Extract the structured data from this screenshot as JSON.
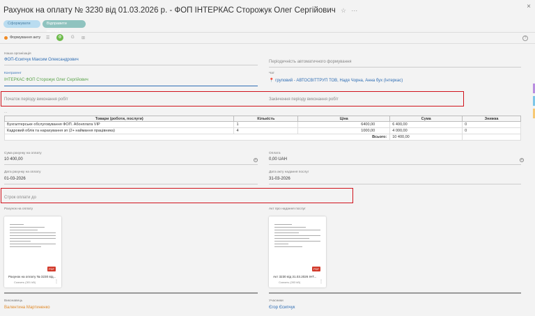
{
  "header": {
    "title": "Рахунок на оплату № 3230 від 01.03.2026 р. - ФОП ІНТЕРКАС Сторожук Олег Сергійович",
    "star_icon": "☆",
    "more_icon": "⋯",
    "close_icon": "×"
  },
  "actions": {
    "form_label": "Сформувати",
    "send_label": "Відправити рахунок"
  },
  "toolbar": {
    "status_label": "Формування акту",
    "status_color": "#f08a24",
    "accent_color": "#6dbb4b"
  },
  "form": {
    "our_org_label": "Наша організація",
    "our_org_value": "ФОП-Єсипчук Максим Олександрович",
    "periodicity_placeholder": "Періодичність автоматичного формування",
    "contractor_label": "Контрагент",
    "contractor_value": "ІНТЕРКАС ФОП Сторожук Олег Сергійович",
    "chat_label": "Чат",
    "chat_value": "груповий - АВТОСВІТТРУП ТОВ, Надя Чорна, Анна бух (Інтеркас)",
    "period_start_placeholder": "Початок періоду виконання робіт",
    "period_end_placeholder": "Закінчення періоду виконання робіт",
    "amount_label": "Сума рахунку на оплату",
    "amount_value": "10 400,00",
    "payment_label": "Оплата",
    "payment_value": "0,00 UAH",
    "invoice_date_label": "Дата рахунку на оплату",
    "invoice_date_value": "01-03-2026",
    "act_date_label": "Дата акту надання послуг",
    "act_date_value": "31-03-2026",
    "due_placeholder": "Строк оплати до",
    "invoice_file_label": "Рахунок на оплату",
    "act_file_label": "Акт про надання послуг",
    "executor_label": "Виконавець",
    "executor_value": "Валентина Мартиненко",
    "participants_label": "Учасники",
    "participants_value": "Єгор Єсипчук"
  },
  "goods": {
    "headers": [
      "Товари (роботи, послуги)",
      "Кількість",
      "Ціна",
      "Сума",
      "Знижка"
    ],
    "rows": [
      [
        "Бухгалтерське обслуговування ФОП. Абонплата VIP",
        "1",
        "6400,00",
        "6 400,00",
        "0"
      ],
      [
        "Кадровий облік та нарахування зп (2+ наймання працівника)",
        "4",
        "1000,00",
        "4 000,00",
        "0"
      ]
    ],
    "total_label": "Всього:",
    "total_value": "10 400,00"
  },
  "files": [
    {
      "caption": "Рахунок на оплату № 3230 від...",
      "size": "Скачать (301 kB)",
      "badge": "PDF"
    },
    {
      "caption": "Акт 3230 від 31.03.2026 ІНТ...",
      "size": "Скачать (283 kB)",
      "badge": "PDF"
    }
  ]
}
